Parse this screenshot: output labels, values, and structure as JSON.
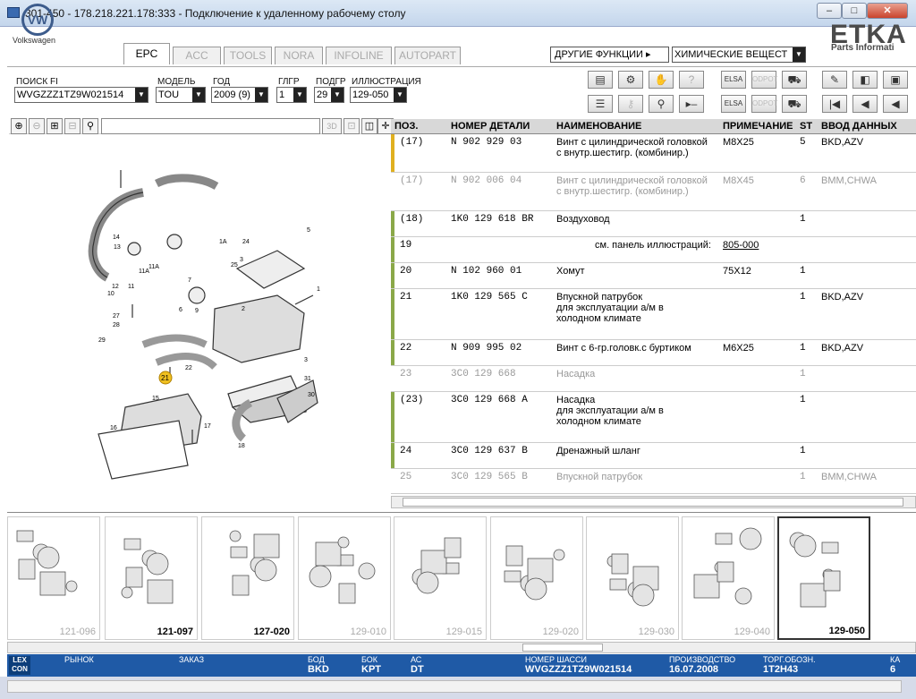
{
  "window": {
    "title": "301-450 - 178.218.221.178:333 - Подключение к удаленному рабочему столу",
    "minimize": "–",
    "maximize": "□",
    "close": "✕"
  },
  "brand": {
    "vw_logo": "VW",
    "vw_name": "Volkswagen",
    "etka": "ETKA",
    "etka_sub": "Parts Informati"
  },
  "tabs": [
    "EPC",
    "ACC",
    "TOOLS",
    "NORA",
    "INFOLINE",
    "AUTOPART"
  ],
  "other_functions": {
    "label": "ДРУГИЕ ФУНКЦИИ",
    "selected": "ХИМИЧЕСКИЕ ВЕЩЕСТ"
  },
  "filters": {
    "fi_label": "ПОИСК FI",
    "fi_value": "WVGZZZ1TZ9W021514",
    "model_label": "МОДЕЛЬ",
    "model_value": "TOU",
    "year_label": "ГОД",
    "year_value": "2009 (9)",
    "mg_label": "ГЛГР",
    "mg_value": "1",
    "sg_label": "ПОДГР",
    "sg_value": "29",
    "illus_label": "ИЛЛЮСТРАЦИЯ",
    "illus_value": "129-050"
  },
  "toolbar_icons": [
    "print-icon",
    "parts-icon",
    "handshake-icon",
    "help-icon",
    "elsa-icon",
    "odpot-icon",
    "cart-icon",
    "pin-icon",
    "prev-doc-icon",
    "next-doc-icon",
    "list-icon",
    "key-icon",
    "bike-icon",
    "play-minus-icon",
    "elsa2-icon",
    "odpot2-icon",
    "cart-add-icon",
    "first-icon",
    "prev-icon",
    "back-icon"
  ],
  "zoom": {
    "label_3d": "3D"
  },
  "table": {
    "headers": {
      "pos": "ПОЗ.",
      "part": "НОМЕР ДЕТАЛИ",
      "name": "НАИМЕНОВАНИЕ",
      "note": "ПРИМЕЧАНИЕ",
      "st": "ST",
      "vin": "ВВОД ДАННЫХ"
    },
    "rows": [
      {
        "pos": "(17)",
        "part": "N     902 929 03",
        "name": "Винт с цилиндрической головкой\nс внутр.шестигр. (комбинир.)",
        "note": "M8X25",
        "st": "5",
        "vin": "BKD,AZV",
        "dim": false,
        "mark": "#e0b020"
      },
      {
        "pos": "(17)",
        "part": "N     902 006 04",
        "name": "Винт с цилиндрической головкой\nс внутр.шестигр. (комбинир.)",
        "note": "M8X45",
        "st": "6",
        "vin": "BMM,CHWA",
        "dim": true,
        "mark": ""
      },
      {
        "pos": "(18)",
        "part": "1K0 129 618 BR",
        "name": "Воздуховод",
        "note": "",
        "st": "1",
        "vin": "",
        "dim": false,
        "mark": "#8aa848"
      },
      {
        "pos": "19",
        "part": "",
        "name": "см. панель иллюстраций:",
        "note": "805-000",
        "st": "",
        "vin": "",
        "dim": false,
        "mark": "#8aa848"
      },
      {
        "pos": "20",
        "part": "N     102 960 01",
        "name": "Хомут",
        "note": "75X12",
        "st": "1",
        "vin": "",
        "dim": false,
        "mark": "#8aa848"
      },
      {
        "pos": "21",
        "part": "1K0 129 565 C",
        "name": "Впускной патрубок\nдля эксплуатации а/м в\nхолодном климате",
        "note": "",
        "st": "1",
        "vin": "BKD,AZV",
        "dim": false,
        "mark": "#8aa848"
      },
      {
        "pos": "22",
        "part": "N     909 995 02",
        "name": "Винт с 6-гр.головк.с буртиком",
        "note": "M6X25",
        "st": "1",
        "vin": "BKD,AZV",
        "dim": false,
        "mark": "#8aa848"
      },
      {
        "pos": "23",
        "part": "3C0 129 668",
        "name": "Насадка",
        "note": "",
        "st": "1",
        "vin": "",
        "dim": true,
        "mark": ""
      },
      {
        "pos": "(23)",
        "part": "3C0 129 668 A",
        "name": "Насадка\nдля эксплуатации а/м в\nхолодном климате",
        "note": "",
        "st": "1",
        "vin": "",
        "dim": false,
        "mark": "#8aa848"
      },
      {
        "pos": "24",
        "part": "3C0 129 637 B",
        "name": "Дренажный шланг",
        "note": "",
        "st": "1",
        "vin": "",
        "dim": false,
        "mark": "#8aa848"
      },
      {
        "pos": "25",
        "part": "3C0 129 565 B",
        "name": "Впускной патрубок",
        "note": "",
        "st": "1",
        "vin": "BMM,CHWA",
        "dim": true,
        "mark": ""
      }
    ]
  },
  "illustration_labels": [
    "1",
    "1A",
    "2",
    "3",
    "4",
    "5",
    "6",
    "7",
    "8",
    "9",
    "10",
    "11",
    "11A",
    "12",
    "13",
    "14",
    "15",
    "16",
    "17",
    "18",
    "21",
    "22",
    "24",
    "25",
    "26",
    "27",
    "28",
    "29",
    "30",
    "31"
  ],
  "illustration_highlight": "21",
  "thumbnails": [
    {
      "num": "121-096",
      "selected": false,
      "dark": false
    },
    {
      "num": "121-097",
      "selected": false,
      "dark": true
    },
    {
      "num": "127-020",
      "selected": false,
      "dark": true
    },
    {
      "num": "129-010",
      "selected": false,
      "dark": false
    },
    {
      "num": "129-015",
      "selected": false,
      "dark": false
    },
    {
      "num": "129-020",
      "selected": false,
      "dark": false
    },
    {
      "num": "129-030",
      "selected": false,
      "dark": false
    },
    {
      "num": "129-040",
      "selected": false,
      "dark": false
    },
    {
      "num": "129-050",
      "selected": true,
      "dark": true
    }
  ],
  "status": {
    "logo": "LEX\nCON",
    "market_label": "РЫНОК",
    "order_label": "ЗАКАЗ",
    "engine_label": "БОД",
    "engine_value": "BKD",
    "gearbox_label": "БОК",
    "gearbox_value": "KPT",
    "axle_label": "АС",
    "axle_value": "DT",
    "chassis_label": "НОМЕР ШАССИ",
    "chassis_value": "WVGZZZ1TZ9W021514",
    "prod_label": "ПРОИЗВОДСТВО",
    "prod_value": "16.07.2008",
    "trade_label": "ТОРГ.ОБОЗН.",
    "trade_value": "1T2H43",
    "k_label": "КА",
    "k_value": "6"
  }
}
